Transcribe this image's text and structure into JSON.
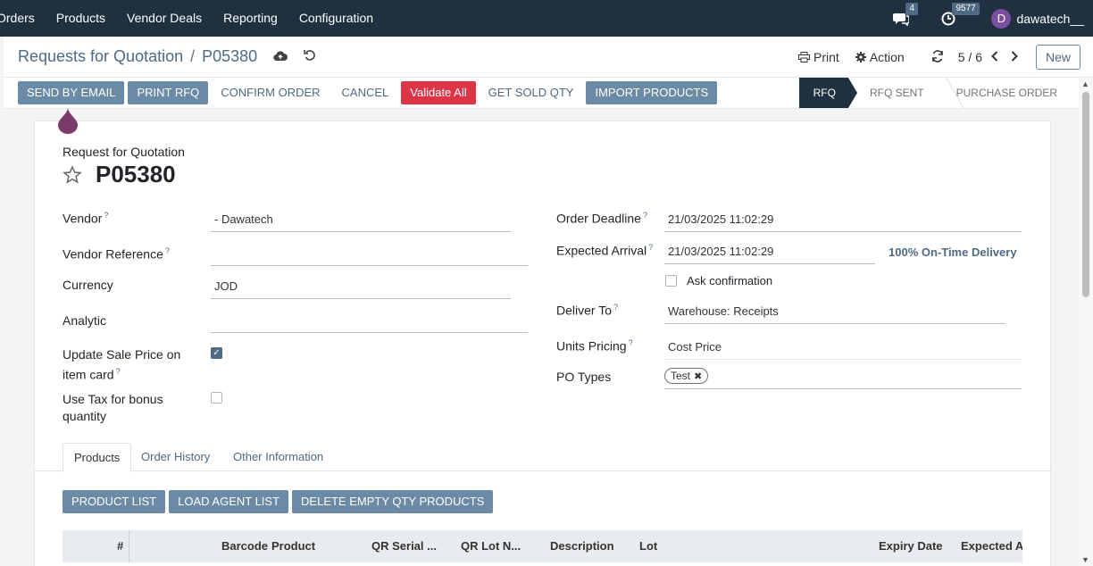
{
  "navbar": {
    "menu": [
      "Orders",
      "Products",
      "Vendor Deals",
      "Reporting",
      "Configuration"
    ],
    "messages_count": "4",
    "activities_count": "9577",
    "user_initial": "D",
    "user_name": "dawatech__"
  },
  "control": {
    "breadcrumb_parent": "Requests for Quotation",
    "breadcrumb_current": "P05380",
    "print_label": "Print",
    "action_label": "Action",
    "pager": "5 / 6",
    "new_label": "New"
  },
  "statusbar": {
    "buttons": {
      "send_email": "SEND BY EMAIL",
      "print_rfq": "PRINT RFQ",
      "confirm": "CONFIRM ORDER",
      "cancel": "CANCEL",
      "validate_all": "Validate All",
      "get_sold_qty": "GET SOLD QTY",
      "import_products": "IMPORT PRODUCTS"
    },
    "stages": [
      "RFQ",
      "RFQ SENT",
      "PURCHASE ORDER"
    ]
  },
  "form": {
    "title_label": "Request for Quotation",
    "name": "P05380",
    "vendor_label": "Vendor",
    "vendor_value": "- Dawatech",
    "vendor_ref_label": "Vendor Reference",
    "vendor_ref_value": "",
    "currency_label": "Currency",
    "currency_value": "JOD",
    "analytic_label": "Analytic",
    "analytic_value": "",
    "update_price_label": "Update Sale Price on item card",
    "use_tax_label": "Use Tax for bonus quantity",
    "order_deadline_label": "Order Deadline",
    "order_deadline_value": "21/03/2025 11:02:29",
    "expected_arrival_label": "Expected Arrival",
    "expected_arrival_value": "21/03/2025 11:02:29",
    "ontime": "100% On-Time Delivery",
    "ask_confirmation_label": "Ask confirmation",
    "deliver_to_label": "Deliver To",
    "deliver_to_value": "Warehouse: Receipts",
    "units_pricing_label": "Units Pricing",
    "units_pricing_value": "Cost Price",
    "po_types_label": "PO Types",
    "po_types_tag": "Test"
  },
  "tabs": [
    "Products",
    "Order History",
    "Other Information"
  ],
  "product_buttons": [
    "PRODUCT LIST",
    "LOAD AGENT LIST",
    "DELETE EMPTY QTY PRODUCTS"
  ],
  "table_headers": [
    "#",
    "Barcode",
    "Product",
    "QR Serial ...",
    "QR Lot N...",
    "Description",
    "Lot",
    "Expiry Date",
    "Expected Ar"
  ]
}
